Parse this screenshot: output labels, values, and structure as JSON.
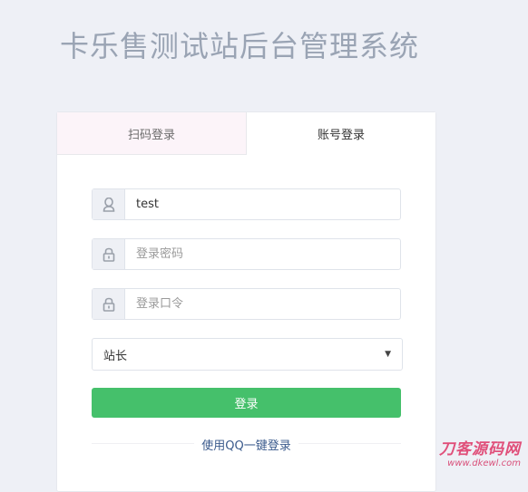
{
  "page": {
    "title": "卡乐售测试站后台管理系统"
  },
  "tabs": {
    "qr_label": "扫码登录",
    "account_label": "账号登录"
  },
  "form": {
    "username_value": "test",
    "password_placeholder": "登录密码",
    "token_placeholder": "登录口令",
    "role_selected": "站长",
    "login_label": "登录",
    "qq_login_label": "使用QQ一键登录"
  },
  "watermark": {
    "main": "刀客源码网",
    "url": "www.dkewl.com"
  },
  "icons": {
    "user": "user-icon",
    "lock": "lock-icon",
    "caret": "caret-down-icon"
  },
  "colors": {
    "primary_button": "#45c06b",
    "link": "#3a5a8c",
    "background": "#eef0f6",
    "title": "#9aa4b4"
  }
}
